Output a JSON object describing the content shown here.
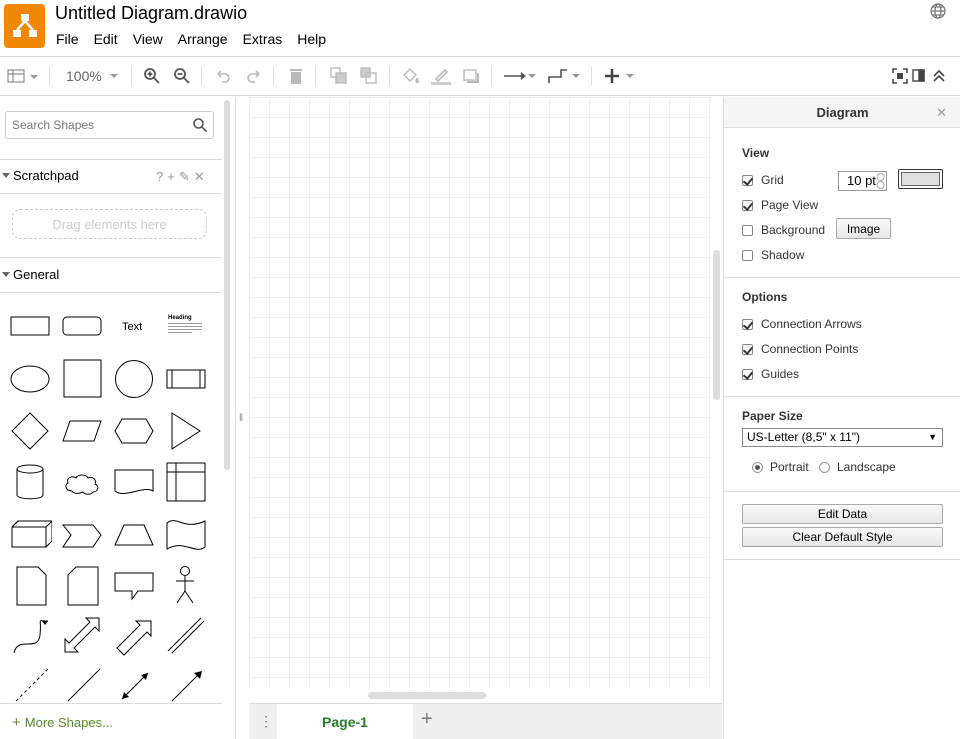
{
  "app": {
    "title": "Untitled Diagram.drawio"
  },
  "menu": [
    "File",
    "Edit",
    "View",
    "Arrange",
    "Extras",
    "Help"
  ],
  "toolbar": {
    "zoom": "100%"
  },
  "sidebar": {
    "search_placeholder": "Search Shapes",
    "scratchpad": {
      "title": "Scratchpad",
      "help": "?",
      "drop_text": "Drag elements here"
    },
    "general": {
      "title": "General",
      "text_shape": "Text",
      "heading_shape": "Heading"
    },
    "more_shapes": "More Shapes..."
  },
  "pages": {
    "current": "Page-1"
  },
  "panel": {
    "title": "Diagram",
    "view": {
      "title": "View",
      "grid_label": "Grid",
      "grid_value": "10 pt",
      "page_view_label": "Page View",
      "background_label": "Background",
      "image_button": "Image",
      "shadow_label": "Shadow"
    },
    "options": {
      "title": "Options",
      "connection_arrows": "Connection Arrows",
      "connection_points": "Connection Points",
      "guides": "Guides"
    },
    "paper": {
      "title": "Paper Size",
      "size": "US-Letter (8,5\" x 11\")",
      "portrait": "Portrait",
      "landscape": "Landscape"
    },
    "buttons": {
      "edit_data": "Edit Data",
      "clear_style": "Clear Default Style"
    }
  }
}
